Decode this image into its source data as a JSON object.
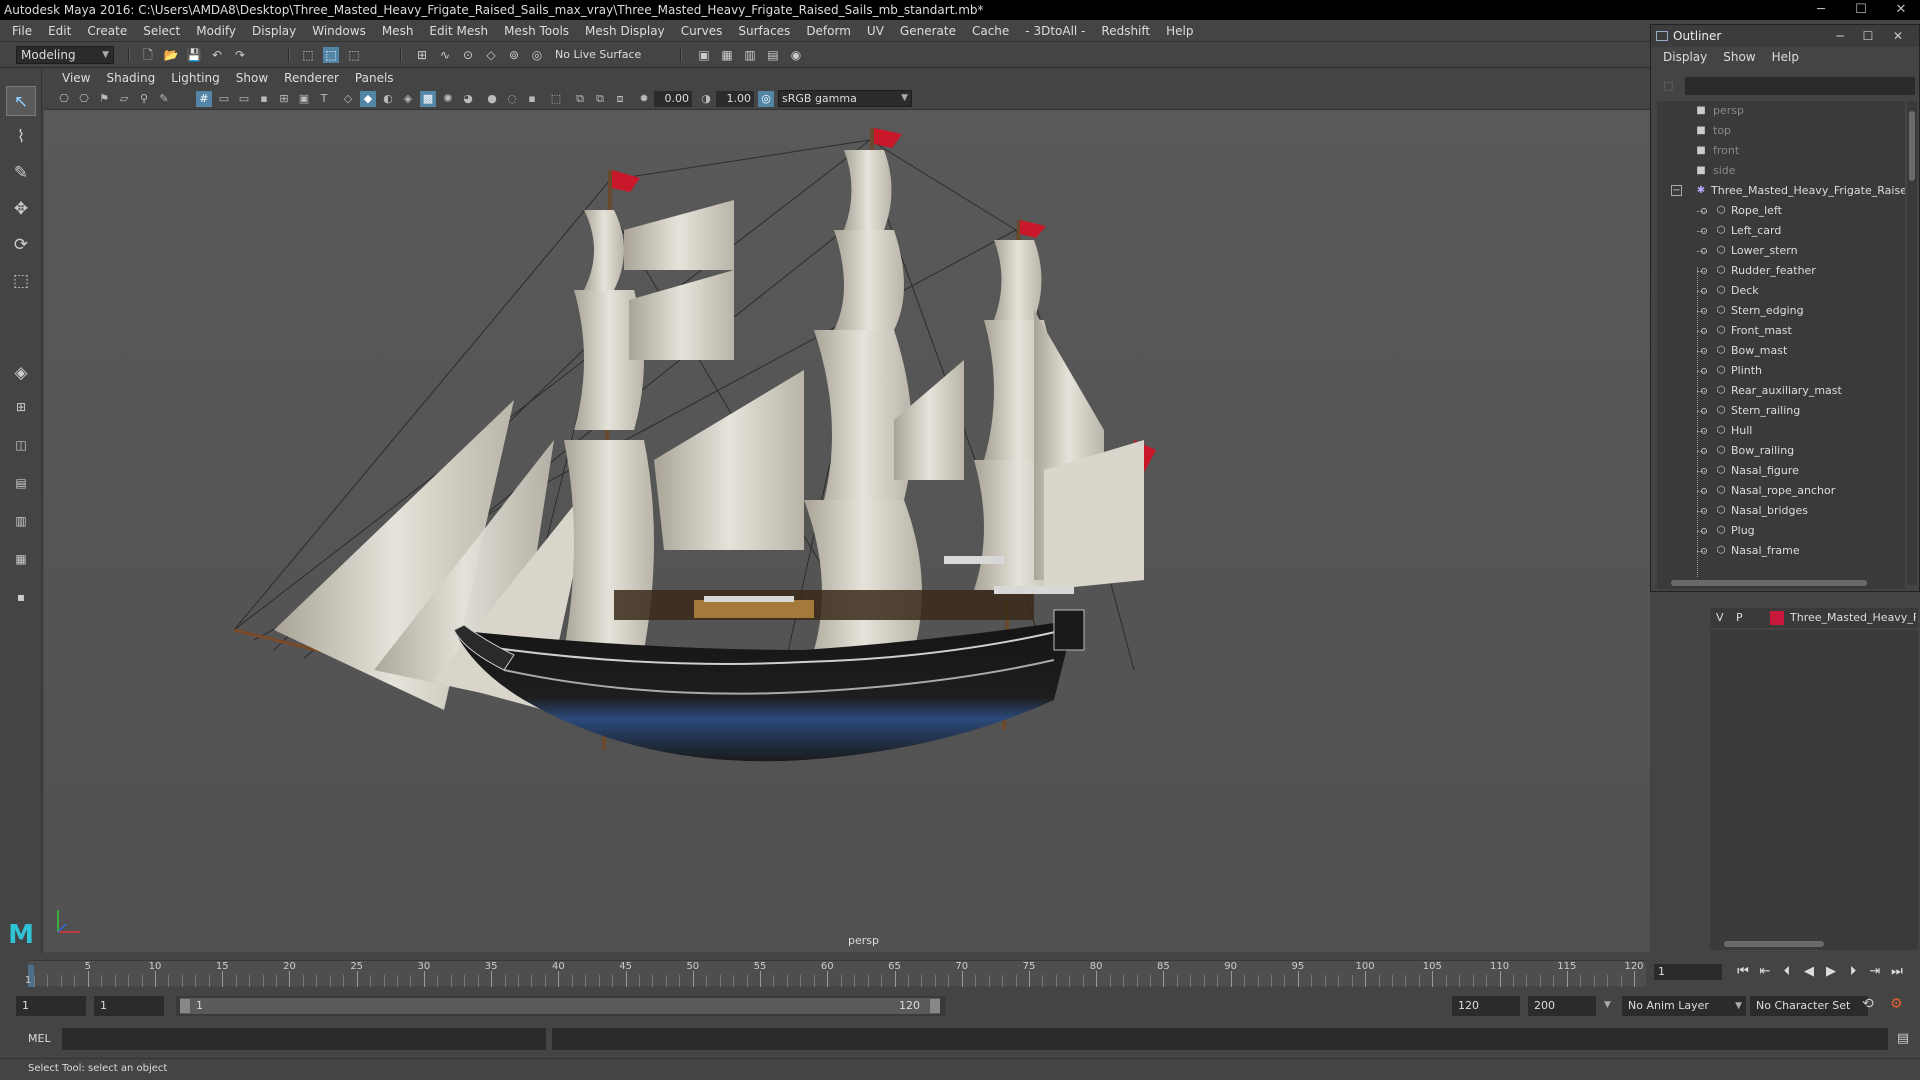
{
  "window": {
    "title": "Autodesk Maya 2016: C:\\Users\\AMDA8\\Desktop\\Three_Masted_Heavy_Frigate_Raised_Sails_max_vray\\Three_Masted_Heavy_Frigate_Raised_Sails_mb_standart.mb*",
    "minimize": "─",
    "maximize": "☐",
    "close": "✕"
  },
  "menubar": [
    "File",
    "Edit",
    "Create",
    "Select",
    "Modify",
    "Display",
    "Windows",
    "Mesh",
    "Edit Mesh",
    "Mesh Tools",
    "Mesh Display",
    "Curves",
    "Surfaces",
    "Deform",
    "UV",
    "Generate",
    "Cache",
    "- 3DtoAll -",
    "Redshift",
    "Help"
  ],
  "shelf": {
    "mode": "Modeling",
    "live_surface": "No Live Surface"
  },
  "viewport": {
    "menu": [
      "View",
      "Shading",
      "Lighting",
      "Show",
      "Renderer",
      "Panels"
    ],
    "exposure": "0.00",
    "gamma": "1.00",
    "color_space": "sRGB gamma",
    "camera_label": "persp"
  },
  "outliner": {
    "title": "Outliner",
    "menu": [
      "Display",
      "Show",
      "Help"
    ],
    "cameras": [
      "persp",
      "top",
      "front",
      "side"
    ],
    "root": "Three_Masted_Heavy_Frigate_Raised",
    "children": [
      "Rope_left",
      "Left_card",
      "Lower_stern",
      "Rudder_feather",
      "Deck",
      "Stern_edging",
      "Front_mast",
      "Bow_mast",
      "Plinth",
      "Rear_auxiliary_mast",
      "Stern_railing",
      "Hull",
      "Bow_railing",
      "Nasal_figure",
      "Nasal_rope_anchor",
      "Nasal_bridges",
      "Plug",
      "Nasal_frame"
    ]
  },
  "layer_editor": {
    "visible": "V",
    "playback": "P",
    "layer_color": "#c8183c",
    "layer_name": "Three_Masted_Heavy_Frigate"
  },
  "timeline": {
    "start": 1,
    "end": 120,
    "labels": [
      "5",
      "10",
      "15",
      "20",
      "25",
      "30",
      "35",
      "40",
      "45",
      "50",
      "55",
      "60",
      "65",
      "70",
      "75",
      "80",
      "85",
      "90",
      "95",
      "100",
      "105",
      "110",
      "115",
      "120"
    ],
    "current_frame_label": "1",
    "current_frame_field": "1"
  },
  "range": {
    "start_field": "1",
    "playback_start": "1",
    "slider_start": "1",
    "slider_end": "120",
    "playback_end": "120",
    "end_field": "200",
    "anim_layer": "No Anim Layer",
    "character_set": "No Character Set"
  },
  "command": {
    "language": "MEL",
    "status": "Select Tool: select an object"
  }
}
